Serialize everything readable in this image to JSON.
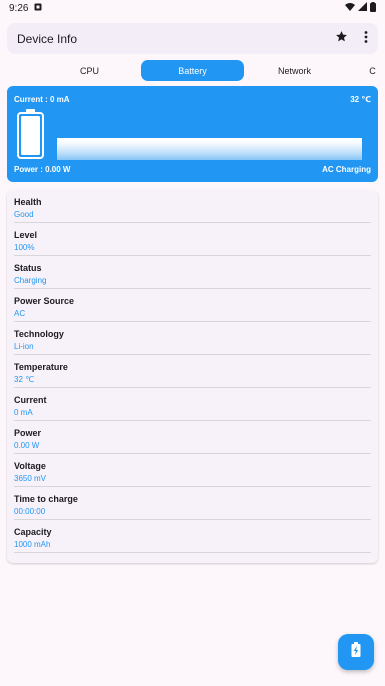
{
  "status_bar": {
    "time": "9:26"
  },
  "app_bar": {
    "title": "Device Info",
    "icons": [
      "star-icon",
      "more-vert-icon"
    ]
  },
  "tabs": [
    {
      "label": "CPU",
      "active": false
    },
    {
      "label": "Battery",
      "active": true
    },
    {
      "label": "Network",
      "active": false
    },
    {
      "label": "C",
      "active": false
    }
  ],
  "battery_card": {
    "current": "Current : 0 mA",
    "temperature": "32 ℃",
    "power": "Power : 0.00 W",
    "charging": "AC Charging",
    "color": "#2196f3"
  },
  "info": [
    {
      "label": "Health",
      "value": "Good"
    },
    {
      "label": "Level",
      "value": "100%"
    },
    {
      "label": "Status",
      "value": "Charging"
    },
    {
      "label": "Power Source",
      "value": "AC"
    },
    {
      "label": "Technology",
      "value": "Li-ion"
    },
    {
      "label": "Temperature",
      "value": "32 ℃"
    },
    {
      "label": "Current",
      "value": "0 mA"
    },
    {
      "label": "Power",
      "value": "0.00 W"
    },
    {
      "label": "Voltage",
      "value": "3650 mV"
    },
    {
      "label": "Time to charge",
      "value": "00:00:00"
    },
    {
      "label": "Capacity",
      "value": "1000 mAh"
    }
  ],
  "fab": {
    "icon": "battery-charging-icon"
  }
}
